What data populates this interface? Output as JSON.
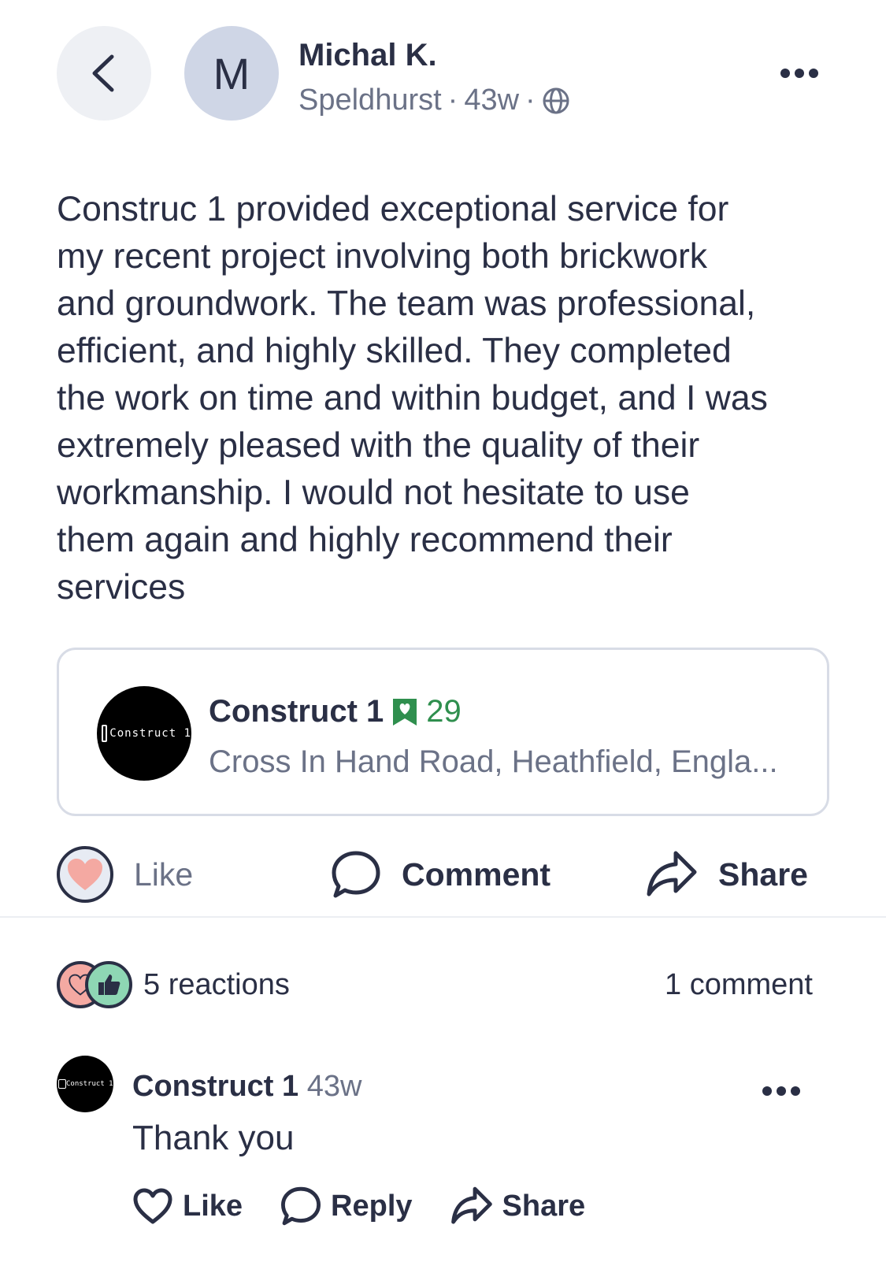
{
  "header": {
    "avatar_initial": "M",
    "author": "Michal K.",
    "location": "Speldhurst",
    "age": "43w",
    "separator": "·"
  },
  "post": {
    "text": "Construc 1 provided exceptional service for\nmy recent project involving both brickwork\nand groundwork.  The team was professional,\nefficient, and highly skilled.  They completed\nthe work on time and within budget, and I was\nextremely pleased with the quality of their\nworkmanship. I would not hesitate to use\nthem again and highly recommend their\nservices"
  },
  "business": {
    "logo_text": "Construct 1",
    "name": "Construct 1",
    "count": "29",
    "address": "Cross In Hand Road, Heathfield,  Engla..."
  },
  "actions": {
    "like": "Like",
    "comment": "Comment",
    "share": "Share"
  },
  "stats": {
    "reactions": "5 reactions",
    "comments": "1 comment"
  },
  "comment": {
    "logo_text": "Construct 1",
    "author": "Construct 1",
    "age": "43w",
    "text": "Thank you",
    "like": "Like",
    "reply": "Reply",
    "share": "Share"
  },
  "colors": {
    "text": "#2a2f45",
    "muted": "#6b7287",
    "accent_green": "#2f8f4e",
    "heart": "#f4a9a2",
    "thumb": "#8ed7b4"
  },
  "icons": [
    "back-chevron-icon",
    "globe-icon",
    "more-dots-icon",
    "favorite-badge-icon",
    "heart-icon",
    "comment-bubble-icon",
    "share-arrow-icon",
    "thumbs-up-icon"
  ]
}
